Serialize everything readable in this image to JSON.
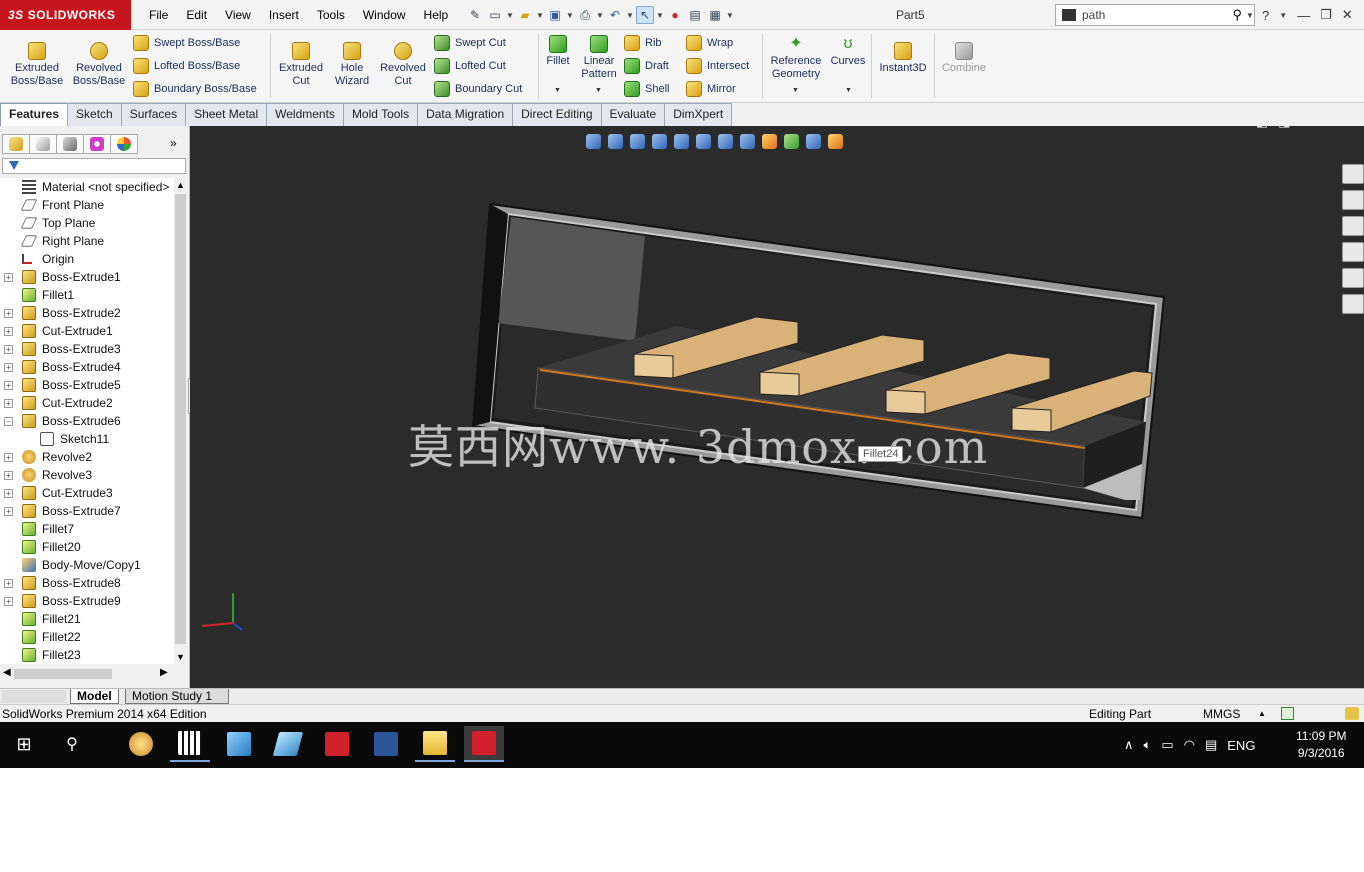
{
  "app": {
    "logo_brand": "3DS SOLIDWORKS",
    "logo_ds": "3S",
    "logo_text": "SOLIDWORKS",
    "document_title": "Part5"
  },
  "menu": [
    "File",
    "Edit",
    "View",
    "Insert",
    "Tools",
    "Window",
    "Help"
  ],
  "search": {
    "value": "path",
    "placeholder": "path"
  },
  "ribbon": {
    "extruded_boss": [
      "Extruded",
      "Boss/Base"
    ],
    "revolved_boss": [
      "Revolved",
      "Boss/Base"
    ],
    "swept_boss": "Swept Boss/Base",
    "lofted_boss": "Lofted Boss/Base",
    "boundary_boss": "Boundary Boss/Base",
    "extruded_cut": [
      "Extruded",
      "Cut"
    ],
    "hole_wizard": [
      "Hole",
      "Wizard"
    ],
    "revolved_cut": [
      "Revolved",
      "Cut"
    ],
    "swept_cut": "Swept Cut",
    "lofted_cut": "Lofted Cut",
    "boundary_cut": "Boundary Cut",
    "fillet": "Fillet",
    "linear_pattern": [
      "Linear",
      "Pattern"
    ],
    "rib": "Rib",
    "draft": "Draft",
    "shell": "Shell",
    "wrap": "Wrap",
    "intersect": "Intersect",
    "mirror": "Mirror",
    "reference_geometry": [
      "Reference",
      "Geometry"
    ],
    "curves": "Curves",
    "instant3d": "Instant3D",
    "combine": "Combine"
  },
  "tabs": [
    "Features",
    "Sketch",
    "Surfaces",
    "Sheet Metal",
    "Weldments",
    "Mold Tools",
    "Data Migration",
    "Direct Editing",
    "Evaluate",
    "DimXpert"
  ],
  "feature_tree": [
    {
      "label": "Material <not specified>",
      "icon": "material-icon",
      "expand": false,
      "indent": 0
    },
    {
      "label": "Front Plane",
      "icon": "plane-icon",
      "expand": false,
      "indent": 0
    },
    {
      "label": "Top Plane",
      "icon": "plane-icon",
      "expand": false,
      "indent": 0
    },
    {
      "label": "Right Plane",
      "icon": "plane-icon",
      "expand": false,
      "indent": 0
    },
    {
      "label": "Origin",
      "icon": "origin-icon",
      "expand": false,
      "indent": 0
    },
    {
      "label": "Boss-Extrude1",
      "icon": "extrude-icon",
      "expand": true,
      "indent": 0
    },
    {
      "label": "Fillet1",
      "icon": "fillet-icon",
      "expand": false,
      "indent": 0
    },
    {
      "label": "Boss-Extrude2",
      "icon": "extrude-icon",
      "expand": true,
      "indent": 0
    },
    {
      "label": "Cut-Extrude1",
      "icon": "extrude-icon",
      "expand": true,
      "indent": 0
    },
    {
      "label": "Boss-Extrude3",
      "icon": "extrude-icon",
      "expand": true,
      "indent": 0
    },
    {
      "label": "Boss-Extrude4",
      "icon": "extrude-icon",
      "expand": true,
      "indent": 0
    },
    {
      "label": "Boss-Extrude5",
      "icon": "extrude-icon",
      "expand": true,
      "indent": 0
    },
    {
      "label": "Cut-Extrude2",
      "icon": "extrude-icon",
      "expand": true,
      "indent": 0
    },
    {
      "label": "Boss-Extrude6",
      "icon": "extrude-icon",
      "expand": "open",
      "indent": 0
    },
    {
      "label": "Sketch11",
      "icon": "sketch-icon",
      "expand": false,
      "indent": 1
    },
    {
      "label": "Revolve2",
      "icon": "revolve-icon",
      "expand": true,
      "indent": 0
    },
    {
      "label": "Revolve3",
      "icon": "revolve-icon",
      "expand": true,
      "indent": 0
    },
    {
      "label": "Cut-Extrude3",
      "icon": "extrude-icon",
      "expand": true,
      "indent": 0
    },
    {
      "label": "Boss-Extrude7",
      "icon": "extrude-icon",
      "expand": true,
      "indent": 0
    },
    {
      "label": "Fillet7",
      "icon": "fillet-icon",
      "expand": false,
      "indent": 0
    },
    {
      "label": "Fillet20",
      "icon": "fillet-icon",
      "expand": false,
      "indent": 0
    },
    {
      "label": "Body-Move/Copy1",
      "icon": "move-icon",
      "expand": false,
      "indent": 0
    },
    {
      "label": "Boss-Extrude8",
      "icon": "extrude-icon",
      "expand": true,
      "indent": 0
    },
    {
      "label": "Boss-Extrude9",
      "icon": "extrude-icon",
      "expand": true,
      "indent": 0
    },
    {
      "label": "Fillet21",
      "icon": "fillet-icon",
      "expand": false,
      "indent": 0
    },
    {
      "label": "Fillet22",
      "icon": "fillet-icon",
      "expand": false,
      "indent": 0
    },
    {
      "label": "Fillet23",
      "icon": "fillet-icon",
      "expand": false,
      "indent": 0
    }
  ],
  "viewport": {
    "watermark": "莫西网www. 3dmox. com",
    "tooltip": "Fillet24",
    "background": "#2b2b2b",
    "part_color": "#d9b27a"
  },
  "bottom_tabs": [
    "Model",
    "Motion Study 1"
  ],
  "status": {
    "edition": "SolidWorks Premium 2014 x64 Edition",
    "mode": "Editing Part",
    "units": "MMGS",
    "units_arrow": "▲"
  },
  "taskbar": {
    "lang": "ENG",
    "time": "11:09 PM",
    "date": "9/3/2016"
  },
  "colors": {
    "brand_red": "#c4161c",
    "accent_blue": "#2d6ab0"
  }
}
